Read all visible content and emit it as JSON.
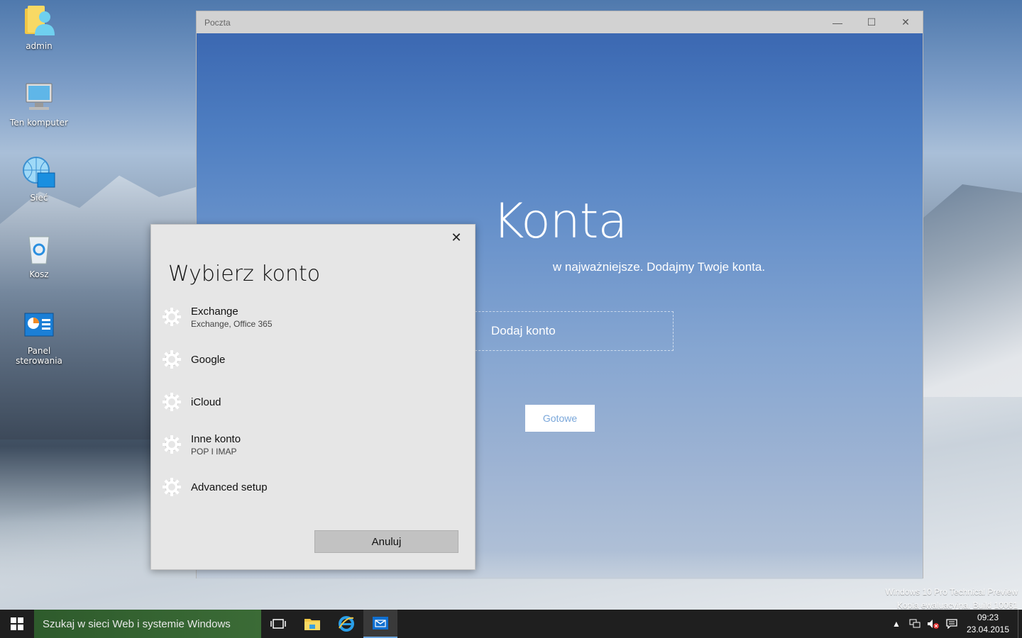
{
  "desktop": {
    "icons": [
      {
        "label": "admin",
        "icon": "user-folder-icon"
      },
      {
        "label": "Ten komputer",
        "icon": "computer-icon"
      },
      {
        "label": "Sieć",
        "icon": "network-icon"
      },
      {
        "label": "Kosz",
        "icon": "recycle-bin-icon"
      },
      {
        "label": "Panel sterowania",
        "icon": "control-panel-icon"
      }
    ],
    "watermark": {
      "line1": "Windows 10 Pro Technical Preview",
      "line2": "Kopia ewaluacyjna. Build 10061"
    }
  },
  "mail_window": {
    "title": "Poczta",
    "controls": {
      "minimize": "—",
      "maximize": "☐",
      "close": "✕"
    },
    "heading": "Konta",
    "subtitle": "...najważniejsze. Dodajmy Twoje konta.",
    "subtitle_visible": "w najważniejsze. Dodajmy Twoje konta.",
    "add_account_label": "Dodaj konto",
    "done_label": "Gotowe"
  },
  "dialog": {
    "title": "Wybierz konto",
    "close": "✕",
    "accounts": [
      {
        "name": "Exchange",
        "sub": "Exchange, Office 365",
        "icon": "gear-icon"
      },
      {
        "name": "Google",
        "sub": "",
        "icon": "gear-icon"
      },
      {
        "name": "iCloud",
        "sub": "",
        "icon": "gear-icon"
      },
      {
        "name": "Inne konto",
        "sub": "POP I IMAP",
        "icon": "gear-icon"
      },
      {
        "name": "Advanced setup",
        "sub": "",
        "icon": "gear-icon"
      }
    ],
    "cancel_label": "Anuluj"
  },
  "taskbar": {
    "search_placeholder": "Szukaj w sieci Web i systemie Windows",
    "apps": [
      "task-view-icon",
      "file-explorer-icon",
      "internet-explorer-icon",
      "mail-icon"
    ],
    "tray": {
      "chevron": "▲",
      "time": "09:23",
      "date": "23.04.2015"
    }
  }
}
